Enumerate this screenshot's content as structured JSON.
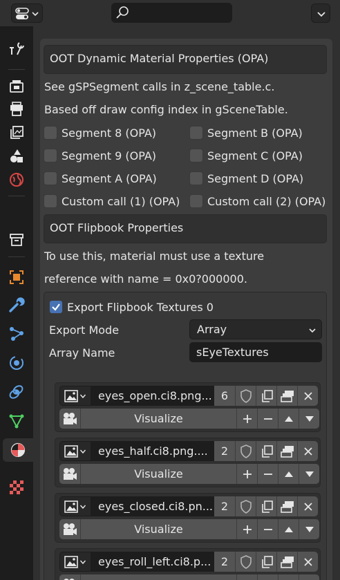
{
  "header": {
    "editor_icon": "properties-editor-icon",
    "search_icon": "search-icon",
    "menu_icon": "chevron-down-icon",
    "search": {
      "value": "",
      "placeholder": ""
    }
  },
  "sidebar": {
    "tabs": [
      {
        "name": "tool",
        "icon": "tool-icon"
      },
      {
        "name": "render",
        "icon": "render-icon"
      },
      {
        "name": "output",
        "icon": "output-icon"
      },
      {
        "name": "view-layer",
        "icon": "view-layer-icon"
      },
      {
        "name": "scene",
        "icon": "scene-icon"
      },
      {
        "name": "world",
        "icon": "world-icon"
      },
      {
        "name": "collection",
        "icon": "collection-icon"
      },
      {
        "name": "object",
        "icon": "object-icon"
      },
      {
        "name": "modifiers",
        "icon": "wrench-icon"
      },
      {
        "name": "particles",
        "icon": "particles-icon"
      },
      {
        "name": "physics",
        "icon": "physics-icon"
      },
      {
        "name": "constraints",
        "icon": "constraints-icon"
      },
      {
        "name": "data",
        "icon": "mesh-data-icon"
      },
      {
        "name": "material",
        "icon": "material-icon",
        "active": true
      },
      {
        "name": "texture",
        "icon": "texture-icon"
      }
    ]
  },
  "dynamic_material": {
    "title": "OOT Dynamic Material Properties (OPA)",
    "note1": "See gSPSegment calls in z_scene_table.c.",
    "note2": "Based off draw config index in gSceneTable.",
    "checkboxes_left": [
      "Segment 8 (OPA)",
      "Segment 9 (OPA)",
      "Segment A (OPA)",
      "Custom call (1) (OPA)"
    ],
    "checkboxes_right": [
      "Segment B (OPA)",
      "Segment C (OPA)",
      "Segment D (OPA)",
      "Custom call (2) (OPA)"
    ]
  },
  "flipbook": {
    "title": "OOT Flipbook Properties",
    "note1": "To use this, material must use a texture",
    "note2": "reference with name = 0x0?000000.",
    "export_label": "Export Flipbook Textures 0",
    "export_checked": true,
    "export_mode_label": "Export Mode",
    "export_mode_value": "Array",
    "array_name_label": "Array Name",
    "array_name_value": "sEyeTextures",
    "visualize_label": "Visualize",
    "textures": [
      {
        "name": "eyes_open.ci8.png...",
        "users": "6"
      },
      {
        "name": "eyes_half.ci8.png....",
        "users": "2"
      },
      {
        "name": "eyes_closed.ci8.pn...",
        "users": "2"
      },
      {
        "name": "eyes_roll_left.ci8.p...",
        "users": "2"
      }
    ]
  },
  "colors": {
    "checkbox_on": "#4772b3",
    "panel_bg": "#3d3d3d",
    "active_tab": "#303030"
  }
}
